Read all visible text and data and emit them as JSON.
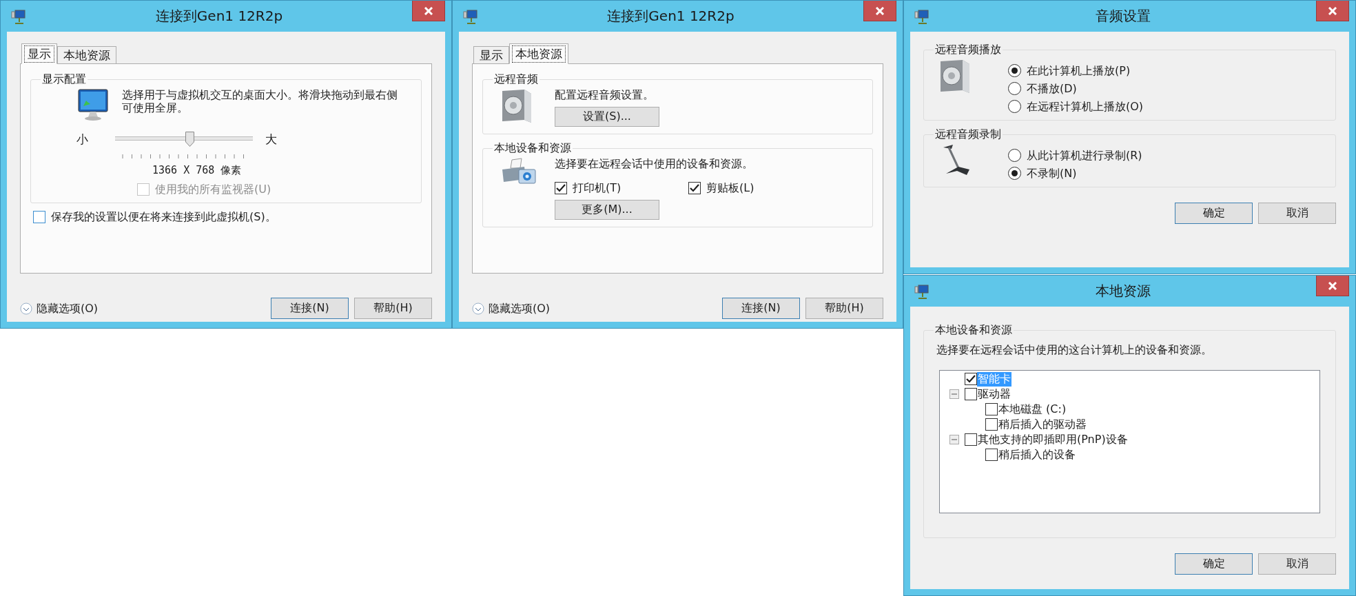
{
  "connect_display": {
    "title": "连接到Gen1 12R2p",
    "tabs": [
      {
        "label": "显示",
        "selected": true
      },
      {
        "label": "本地资源",
        "selected": false
      }
    ],
    "display_group": {
      "title": "显示配置",
      "description": "选择用于与虚拟机交互的桌面大小。将滑块拖动到最右侧可使用全屏。",
      "min_label": "小",
      "max_label": "大",
      "slider": {
        "level": 0.54
      },
      "resolution": "1366 X 768 像素",
      "all_monitors": {
        "label": "使用我的所有监视器(U)",
        "checked": false,
        "disabled": true
      }
    },
    "save_settings": {
      "label": "保存我的设置以便在将来连接到此虚拟机(S)。",
      "checked": false
    },
    "footer": {
      "options": "隐藏选项(O)",
      "buttons": [
        {
          "label": "连接(N)",
          "default": true
        },
        {
          "label": "帮助(H)",
          "default": false
        }
      ]
    }
  },
  "connect_local": {
    "title": "连接到Gen1 12R2p",
    "tabs": [
      {
        "label": "显示",
        "selected": false
      },
      {
        "label": "本地资源",
        "selected": true
      }
    ],
    "audio_group": {
      "title": "远程音频",
      "description": "配置远程音频设置。",
      "button": "设置(S)..."
    },
    "devices_group": {
      "title": "本地设备和资源",
      "description": "选择要在远程会话中使用的设备和资源。",
      "options": [
        {
          "label": "打印机(T)",
          "checked": true
        },
        {
          "label": "剪贴板(L)",
          "checked": true
        }
      ],
      "button": "更多(M)..."
    },
    "footer": {
      "options": "隐藏选项(O)",
      "buttons": [
        {
          "label": "连接(N)",
          "default": true
        },
        {
          "label": "帮助(H)",
          "default": false
        }
      ]
    }
  },
  "audio_settings": {
    "title": "音频设置",
    "playback_group": {
      "title": "远程音频播放",
      "options": [
        {
          "label": "在此计算机上播放(P)",
          "selected": true
        },
        {
          "label": "不播放(D)",
          "selected": false
        },
        {
          "label": "在远程计算机上播放(O)",
          "selected": false
        }
      ]
    },
    "recording_group": {
      "title": "远程音频录制",
      "options": [
        {
          "label": "从此计算机进行录制(R)",
          "selected": false
        },
        {
          "label": "不录制(N)",
          "selected": true
        }
      ]
    },
    "buttons": [
      {
        "label": "确定",
        "default": true
      },
      {
        "label": "取消",
        "default": false
      }
    ]
  },
  "local_resources": {
    "title": "本地资源",
    "group": {
      "title": "本地设备和资源",
      "description": "选择要在远程会话中使用的这台计算机上的设备和资源。"
    },
    "tree": [
      {
        "label": "智能卡",
        "checked": true,
        "selected": true
      },
      {
        "label": "驱动器",
        "checked": false,
        "selected": false,
        "expanded": true,
        "children": [
          {
            "label": "本地磁盘 (C:)",
            "checked": false,
            "selected": false
          },
          {
            "label": "稍后插入的驱动器",
            "checked": false,
            "selected": false
          }
        ]
      },
      {
        "label": "其他支持的即插即用(PnP)设备",
        "checked": false,
        "selected": false,
        "expanded": true,
        "children": [
          {
            "label": "稍后插入的设备",
            "checked": false,
            "selected": false
          }
        ]
      }
    ],
    "buttons": [
      {
        "label": "确定",
        "default": true
      },
      {
        "label": "取消",
        "default": false
      }
    ]
  }
}
